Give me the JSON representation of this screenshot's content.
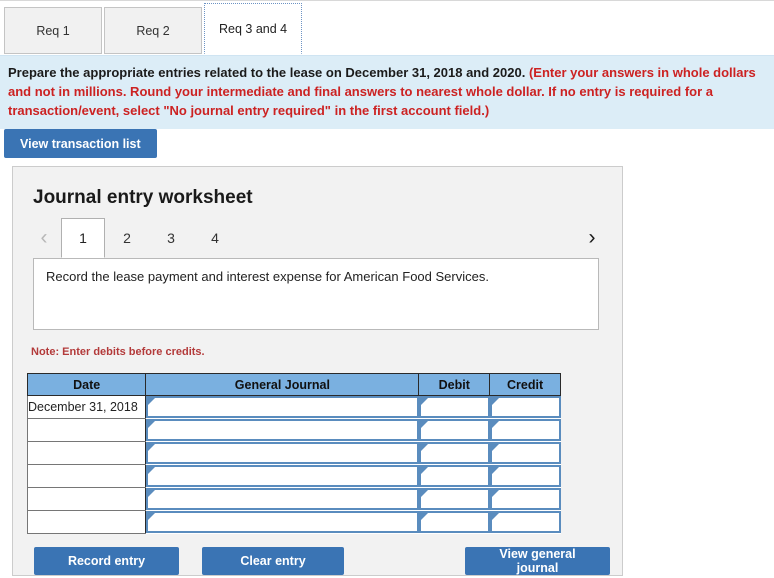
{
  "tabs": [
    {
      "label": "Req 1",
      "active": false
    },
    {
      "label": "Req 2",
      "active": false
    },
    {
      "label": "Req 3 and 4",
      "active": true
    }
  ],
  "instructions": {
    "black_text": "Prepare the appropriate entries related to the lease on December 31, 2018 and 2020. ",
    "red_text": "(Enter your answers in whole dollars and not in millions. Round your intermediate and final answers to nearest whole dollar. If no entry is required for a transaction/event, select \"No journal entry required\" in the first account field.)"
  },
  "view_transaction_list_label": "View transaction list",
  "worksheet": {
    "title": "Journal entry worksheet",
    "pager": {
      "prev_icon": "chevron-left-icon",
      "next_icon": "chevron-right-icon",
      "pages": [
        "1",
        "2",
        "3",
        "4"
      ],
      "active_page": "1"
    },
    "description": "Record the lease payment and interest expense for American Food Services.",
    "note": "Note: Enter debits before credits.",
    "table": {
      "headers": [
        "Date",
        "General Journal",
        "Debit",
        "Credit"
      ],
      "rows": [
        {
          "date": "December 31, 2018",
          "journal": "",
          "debit": "",
          "credit": ""
        },
        {
          "date": "",
          "journal": "",
          "debit": "",
          "credit": ""
        },
        {
          "date": "",
          "journal": "",
          "debit": "",
          "credit": ""
        },
        {
          "date": "",
          "journal": "",
          "debit": "",
          "credit": ""
        },
        {
          "date": "",
          "journal": "",
          "debit": "",
          "credit": ""
        },
        {
          "date": "",
          "journal": "",
          "debit": "",
          "credit": ""
        }
      ]
    },
    "buttons": {
      "record_entry": "Record entry",
      "clear_entry": "Clear entry",
      "view_general_journal": "View general journal"
    }
  },
  "colors": {
    "accent_blue": "#3a74b4",
    "banner_blue": "#dcedf7",
    "header_blue": "#7ab0e0",
    "note_red": "#b33a3a",
    "instruction_red": "#cc2222",
    "input_border_blue": "#5a8cbe"
  }
}
